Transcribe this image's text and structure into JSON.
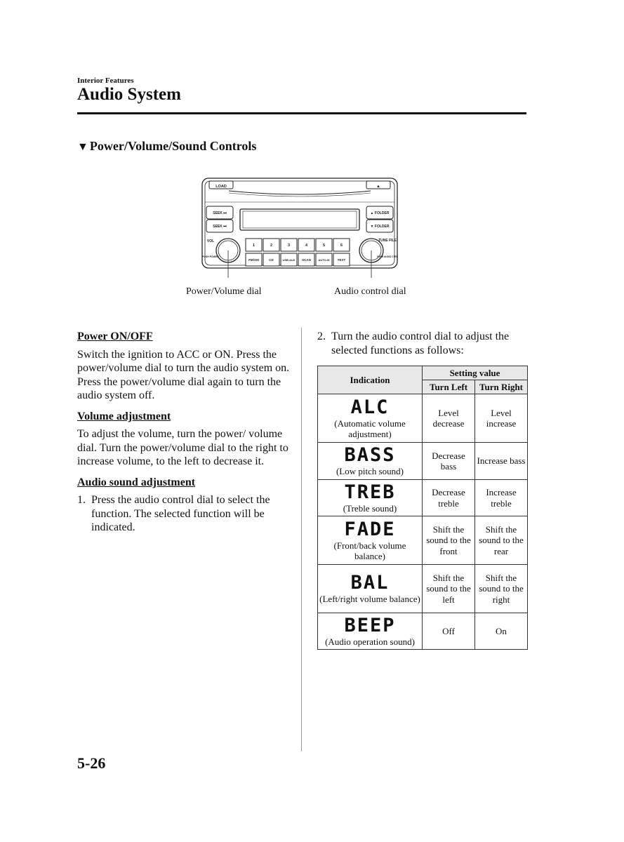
{
  "header": {
    "section_label": "Interior Features",
    "title": "Audio System"
  },
  "subsection": {
    "icon": "down-triangle",
    "title": "Power/Volume/Sound Controls"
  },
  "radio": {
    "buttons": {
      "load": "LOAD",
      "eject": "▲",
      "seek_up": "SEEK ⏭",
      "seek_down": "SEEK ⏮",
      "folder_up": "▲ FOLDER",
      "folder_down": "▼ FOLDER",
      "presets": [
        "1",
        "2",
        "3",
        "4",
        "5",
        "6"
      ],
      "bottom_row": [
        "FM/AM",
        "CD",
        "USB AUX",
        "SCAN",
        "AUTO-M",
        "TEXT"
      ]
    },
    "dial_labels": {
      "vol": "VOL",
      "push_power": "PUSH POWER",
      "tune_file": "TUNE FILE",
      "push_audio_ctrl": "PUSH AUDIO CTRL"
    },
    "callouts": {
      "left": "Power/Volume dial",
      "right": "Audio control dial"
    }
  },
  "left_column": {
    "power_heading": "Power ON/OFF",
    "power_text": "Switch the ignition to ACC or ON. Press the power/volume dial to turn the audio system on. Press the power/volume dial again to turn the audio system off.",
    "volume_heading": "Volume adjustment",
    "volume_text": "To adjust the volume, turn the power/ volume dial. Turn the power/volume dial to the right to increase volume, to the left to decrease it.",
    "sound_heading": "Audio sound adjustment",
    "step1_num": "1.",
    "step1_text": "Press the audio control dial to select the function. The selected function will be indicated."
  },
  "right_column": {
    "step2_num": "2.",
    "step2_text": "Turn the audio control dial to adjust the selected functions as follows:"
  },
  "table": {
    "headers": {
      "indication": "Indication",
      "setting_value": "Setting value",
      "turn_left": "Turn Left",
      "turn_right": "Turn Right"
    },
    "rows": [
      {
        "display": "ALC",
        "desc": "(Automatic volume adjustment)",
        "left": "Level decrease",
        "right": "Level increase"
      },
      {
        "display": "BASS",
        "desc": "(Low pitch sound)",
        "left": "Decrease bass",
        "right": "Increase bass"
      },
      {
        "display": "TREB",
        "desc": "(Treble sound)",
        "left": "Decrease treble",
        "right": "Increase treble"
      },
      {
        "display": "FADE",
        "desc": "(Front/back volume balance)",
        "left": "Shift the sound to the front",
        "right": "Shift the sound to the rear"
      },
      {
        "display": "BAL",
        "desc": "(Left/right volume balance)",
        "left": "Shift the sound to the left",
        "right": "Shift the sound to the right"
      },
      {
        "display": "BEEP",
        "desc": "(Audio operation sound)",
        "left": "Off",
        "right": "On"
      }
    ]
  },
  "footer": {
    "page_number": "5-26"
  }
}
